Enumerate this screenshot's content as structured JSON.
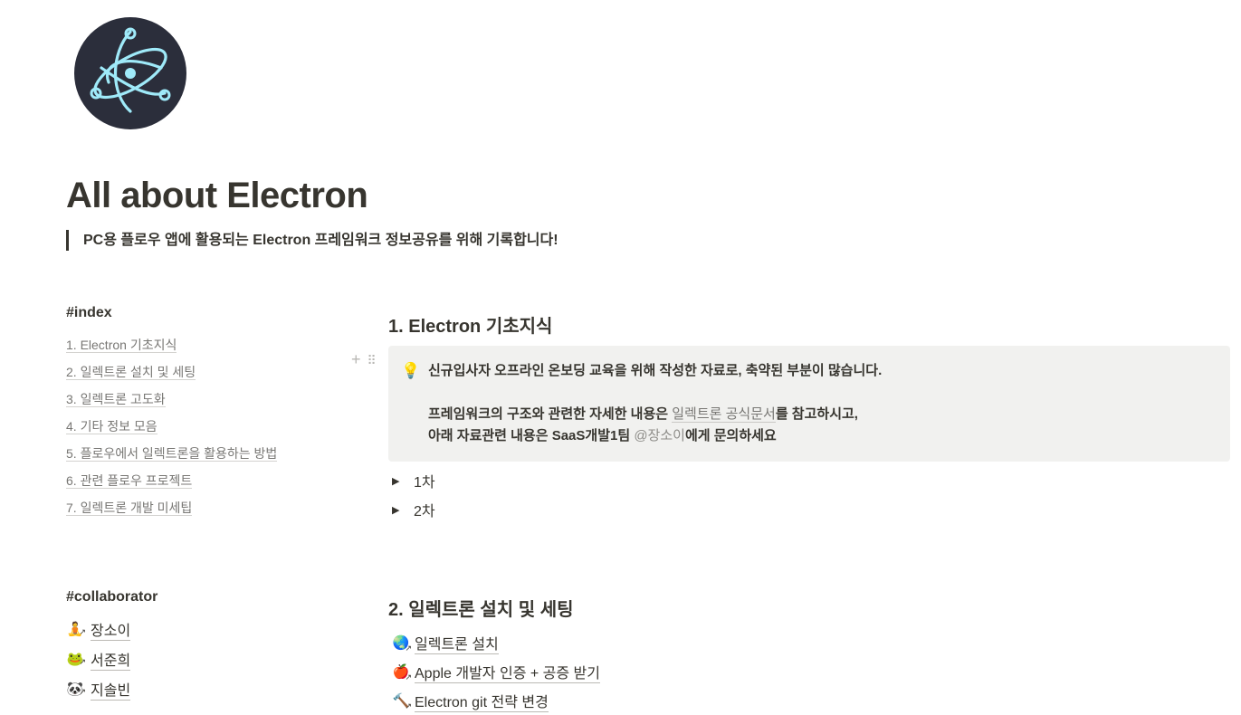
{
  "page": {
    "icon": "electron-logo-icon",
    "title": "All about Electron",
    "quote": "PC용 플로우 앱에 활용되는 Electron 프레임워크 정보공유를 위해 기록합니다!"
  },
  "index": {
    "heading": "#index",
    "items": [
      "1. Electron 기초지식",
      "2. 일렉트론 설치 및 세팅",
      "3. 일렉트론 고도화",
      "4. 기타 정보 모음",
      "5. 플로우에서 일렉트론을 활용하는 방법",
      "6. 관련 플로우 프로젝트",
      "7. 일렉트론 개발 미세팁"
    ]
  },
  "collaborator": {
    "heading": "#collaborator",
    "people": [
      {
        "name": "장소이",
        "icon": "person-emoji-icon"
      },
      {
        "name": "서준희",
        "icon": "frog-emoji-icon"
      },
      {
        "name": "지솔빈",
        "icon": "panda-emoji-icon"
      }
    ]
  },
  "section1": {
    "heading": "1. Electron 기초지식",
    "callout": {
      "icon": "lightbulb-icon",
      "line1": "신규입사자 오프라인 온보딩 교육을 위해 작성한 자료로, 축약된 부분이 많습니다.",
      "line2_pre": "프레임워크의 구조와 관련한 자세한 내용은 ",
      "line2_link": "일렉트론 공식문서",
      "line2_post": "를 참고하시고,",
      "line3_pre": "아래 자료관련 내용은 SaaS개발1팀 ",
      "line3_mention": "@장소이",
      "line3_post": "에게 문의하세요"
    },
    "toggles": [
      "1차",
      "2차"
    ]
  },
  "section2": {
    "heading": "2. 일렉트론 설치 및 세팅",
    "pages": [
      {
        "label": "일렉트론 설치",
        "icon": "globe-emoji-icon"
      },
      {
        "label": "Apple 개발자 인증 + 공증 받기",
        "icon": "apple-emoji-icon"
      },
      {
        "label": "Electron git 전략 변경",
        "icon": "hammer-emoji-icon"
      }
    ]
  },
  "colors": {
    "text": "#37352f",
    "muted": "#787774",
    "callout_bg": "#f1f1ef",
    "logo_bg": "#2b2e3b",
    "logo_stroke": "#9feaf9"
  }
}
